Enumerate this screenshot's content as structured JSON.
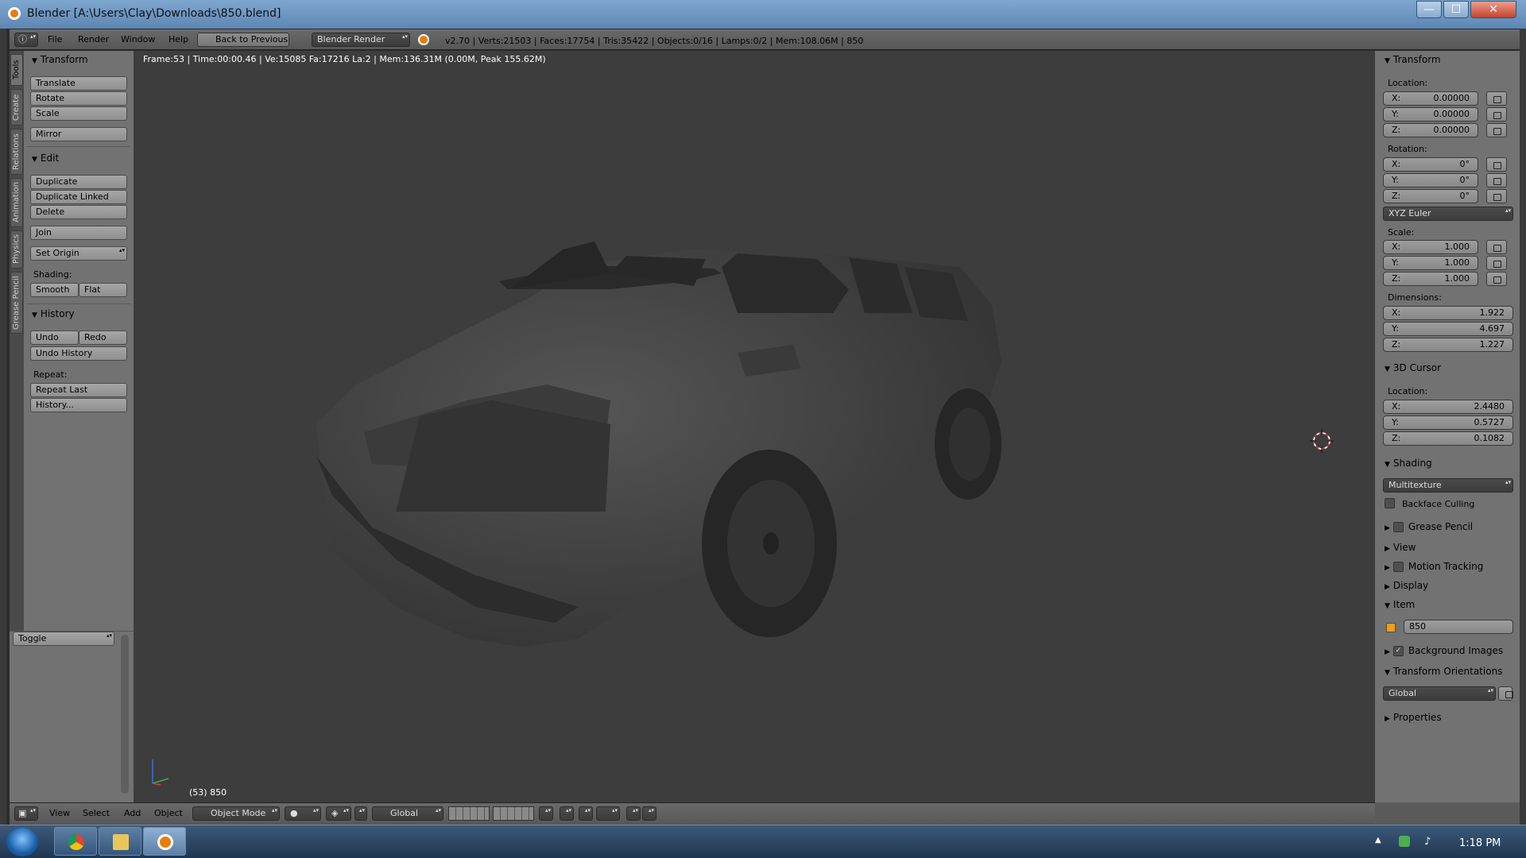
{
  "window": {
    "title": "Blender [A:\\Users\\Clay\\Downloads\\850.blend]",
    "min": "—",
    "max": "☐",
    "close": "✕"
  },
  "menu": {
    "items": [
      "File",
      "Render",
      "Window",
      "Help"
    ],
    "back": "Back to Previous",
    "engine": "Blender Render",
    "stats": "v2.70 | Verts:21503 | Faces:17754 | Tris:35422 | Objects:0/16 | Lamps:0/2 | Mem:108.06M | 850"
  },
  "vtabs": [
    "Tools",
    "Create",
    "Relations",
    "Animation",
    "Physics",
    "Grease Pencil"
  ],
  "tools": {
    "transform": {
      "header": "Transform",
      "translate": "Translate",
      "rotate": "Rotate",
      "scale": "Scale",
      "mirror": "Mirror"
    },
    "edit": {
      "header": "Edit",
      "duplicate": "Duplicate",
      "duplicate_linked": "Duplicate Linked",
      "delete": "Delete",
      "join": "Join",
      "set_origin": "Set Origin",
      "shading_label": "Shading:",
      "smooth": "Smooth",
      "flat": "Flat"
    },
    "history": {
      "header": "History",
      "undo": "Undo",
      "redo": "Redo",
      "undo_history": "Undo History",
      "repeat_label": "Repeat:",
      "repeat_last": "Repeat Last",
      "history": "History..."
    },
    "toggle": "Toggle"
  },
  "viewport": {
    "info": "Frame:53 | Time:00:00.46 | Ve:15085 Fa:17216 La:2 | Mem:136.31M (0.00M, Peak 155.62M)",
    "object": "(53) 850"
  },
  "props": {
    "transform_header": "Transform",
    "location_label": "Location:",
    "location": [
      {
        "k": "X:",
        "v": "0.00000"
      },
      {
        "k": "Y:",
        "v": "0.00000"
      },
      {
        "k": "Z:",
        "v": "0.00000"
      }
    ],
    "rotation_label": "Rotation:",
    "rotation": [
      {
        "k": "X:",
        "v": "0°"
      },
      {
        "k": "Y:",
        "v": "0°"
      },
      {
        "k": "Z:",
        "v": "0°"
      }
    ],
    "rotation_mode": "XYZ Euler",
    "scale_label": "Scale:",
    "scale": [
      {
        "k": "X:",
        "v": "1.000"
      },
      {
        "k": "Y:",
        "v": "1.000"
      },
      {
        "k": "Z:",
        "v": "1.000"
      }
    ],
    "dimensions_label": "Dimensions:",
    "dimensions": [
      {
        "k": "X:",
        "v": "1.922"
      },
      {
        "k": "Y:",
        "v": "4.697"
      },
      {
        "k": "Z:",
        "v": "1.227"
      }
    ],
    "cursor_header": "3D Cursor",
    "cursor_location_label": "Location:",
    "cursor": [
      {
        "k": "X:",
        "v": "2.4480"
      },
      {
        "k": "Y:",
        "v": "0.5727"
      },
      {
        "k": "Z:",
        "v": "0.1082"
      }
    ],
    "shading_header": "Shading",
    "shading_mode": "Multitexture",
    "backface": "Backface Culling",
    "grease": "Grease Pencil",
    "view": "View",
    "motion": "Motion Tracking",
    "display": "Display",
    "item_header": "Item",
    "item_name": "850",
    "bg_images": "Background Images",
    "orient_header": "Transform Orientations",
    "orient": "Global",
    "properties": "Properties"
  },
  "bottom": {
    "view": "View",
    "select": "Select",
    "add": "Add",
    "object": "Object",
    "mode": "Object Mode",
    "orientation": "Global"
  },
  "taskbar": {
    "clock": "1:18 PM"
  }
}
